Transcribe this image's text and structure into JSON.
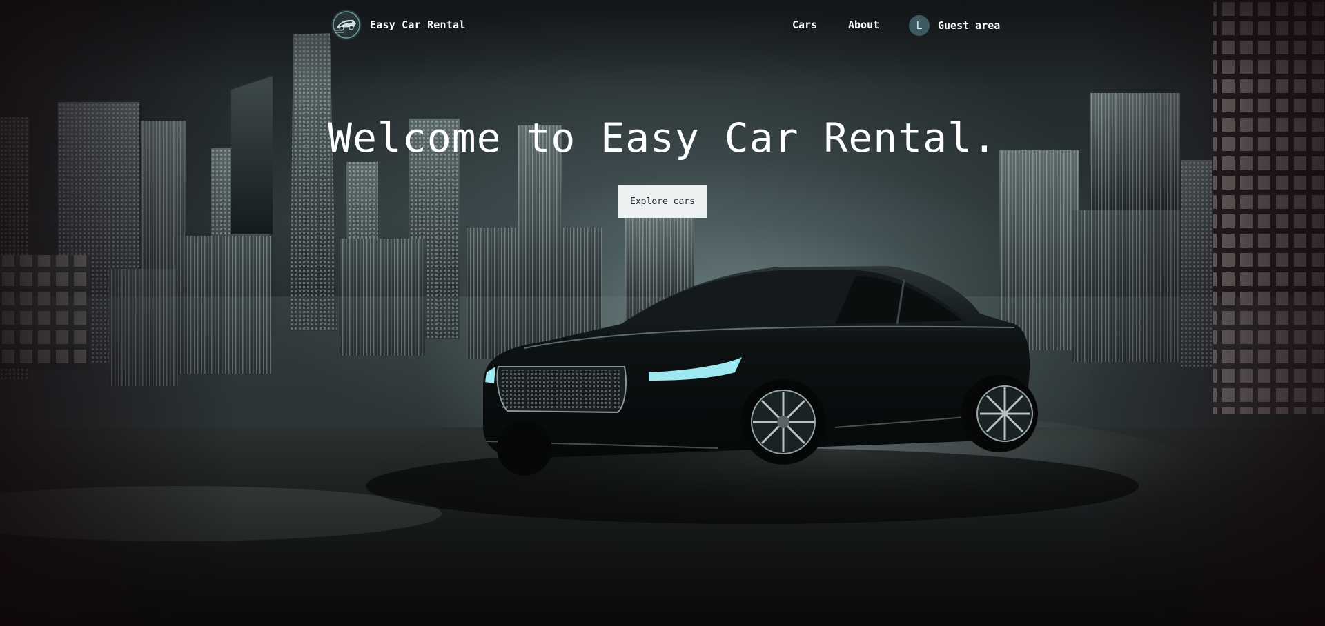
{
  "nav": {
    "brand_name": "Easy Car Rental",
    "logo_icon": "car-logo-icon",
    "links": [
      {
        "label": "Cars"
      },
      {
        "label": "About"
      }
    ],
    "guest": {
      "avatar_initial": "L",
      "label": "Guest area"
    }
  },
  "hero": {
    "title": "Welcome to Easy Car Rental.",
    "cta_label": "Explore cars",
    "background": "night-city-skyline-with-black-sedan"
  },
  "colors": {
    "text": "#ffffff",
    "button_bg": "#eef1f2",
    "button_text": "#1d2528",
    "avatar_bg": "#3c5a60"
  }
}
